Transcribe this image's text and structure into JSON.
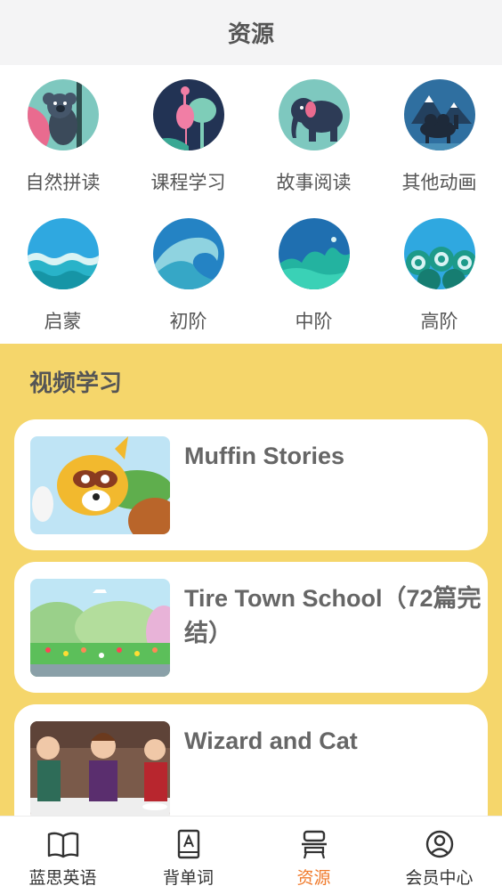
{
  "header": {
    "title": "资源"
  },
  "categories": [
    {
      "label": "自然拼读",
      "icon": "koala-icon"
    },
    {
      "label": "课程学习",
      "icon": "flamingo-icon"
    },
    {
      "label": "故事阅读",
      "icon": "elephant-icon"
    },
    {
      "label": "其他动画",
      "icon": "camel-icon"
    },
    {
      "label": "启蒙",
      "icon": "calm-wave-icon"
    },
    {
      "label": "初阶",
      "icon": "curl-wave-icon"
    },
    {
      "label": "中阶",
      "icon": "big-wave-icon"
    },
    {
      "label": "高阶",
      "icon": "swirl-wave-icon"
    }
  ],
  "video_section": {
    "title": "视频学习",
    "items": [
      {
        "title": "Muffin Stories",
        "thumb": "raccoon-cartoon-thumbnail"
      },
      {
        "title": "Tire Town School（72篇完结）",
        "thumb": "garden-cartoon-thumbnail"
      },
      {
        "title": "Wizard and Cat",
        "thumb": "dinner-party-cartoon-thumbnail"
      }
    ]
  },
  "tabbar": {
    "items": [
      {
        "label": "蓝思英语",
        "icon": "book-open-icon",
        "active": false
      },
      {
        "label": "背单词",
        "icon": "dictionary-icon",
        "active": false
      },
      {
        "label": "资源",
        "icon": "desk-icon",
        "active": true
      },
      {
        "label": "会员中心",
        "icon": "user-circle-icon",
        "active": false
      }
    ]
  },
  "colors": {
    "accent": "#f07a2b",
    "section_bg": "#f5d66b",
    "header_bg": "#f4f4f5"
  }
}
